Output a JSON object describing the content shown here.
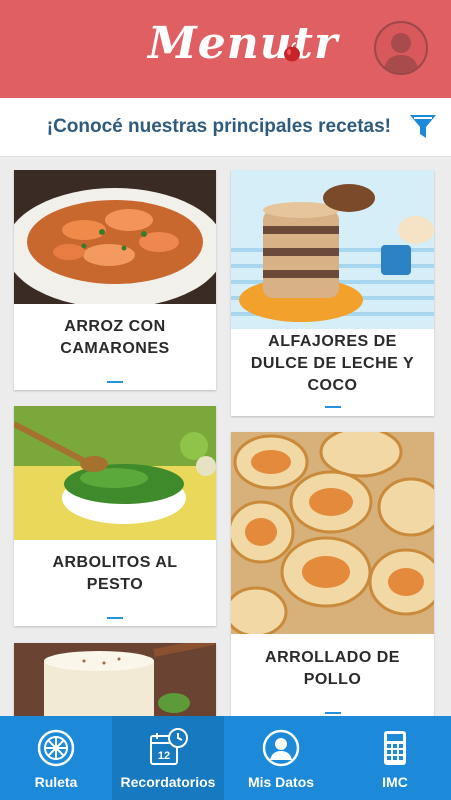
{
  "header": {
    "logo": "Menutr",
    "avatar": "user-avatar"
  },
  "subbar": {
    "subtitle": "¡Conocé nuestras principales recetas!",
    "filter_icon": "filter-icon"
  },
  "recipes": [
    {
      "title": "ARROZ CON CAMARONES"
    },
    {
      "title": "ALFAJORES DE DULCE DE LECHE Y COCO"
    },
    {
      "title": "ARBOLITOS  AL PESTO"
    },
    {
      "title": "ARROLLADO DE POLLO"
    },
    {
      "title": ""
    }
  ],
  "tabs": [
    {
      "label": "Ruleta",
      "icon": "roulette-icon"
    },
    {
      "label": "Recordatorios",
      "icon": "calendar-clock-icon",
      "calendar_number": "12"
    },
    {
      "label": "Mis Datos",
      "icon": "user-circle-icon"
    },
    {
      "label": "IMC",
      "icon": "calculator-icon"
    }
  ],
  "colors": {
    "header": "#e05f62",
    "tabbar": "#1c8ad8",
    "tab_active": "#1779c0",
    "subtitle": "#2f5b7d",
    "accent": "#2a8fd9"
  }
}
